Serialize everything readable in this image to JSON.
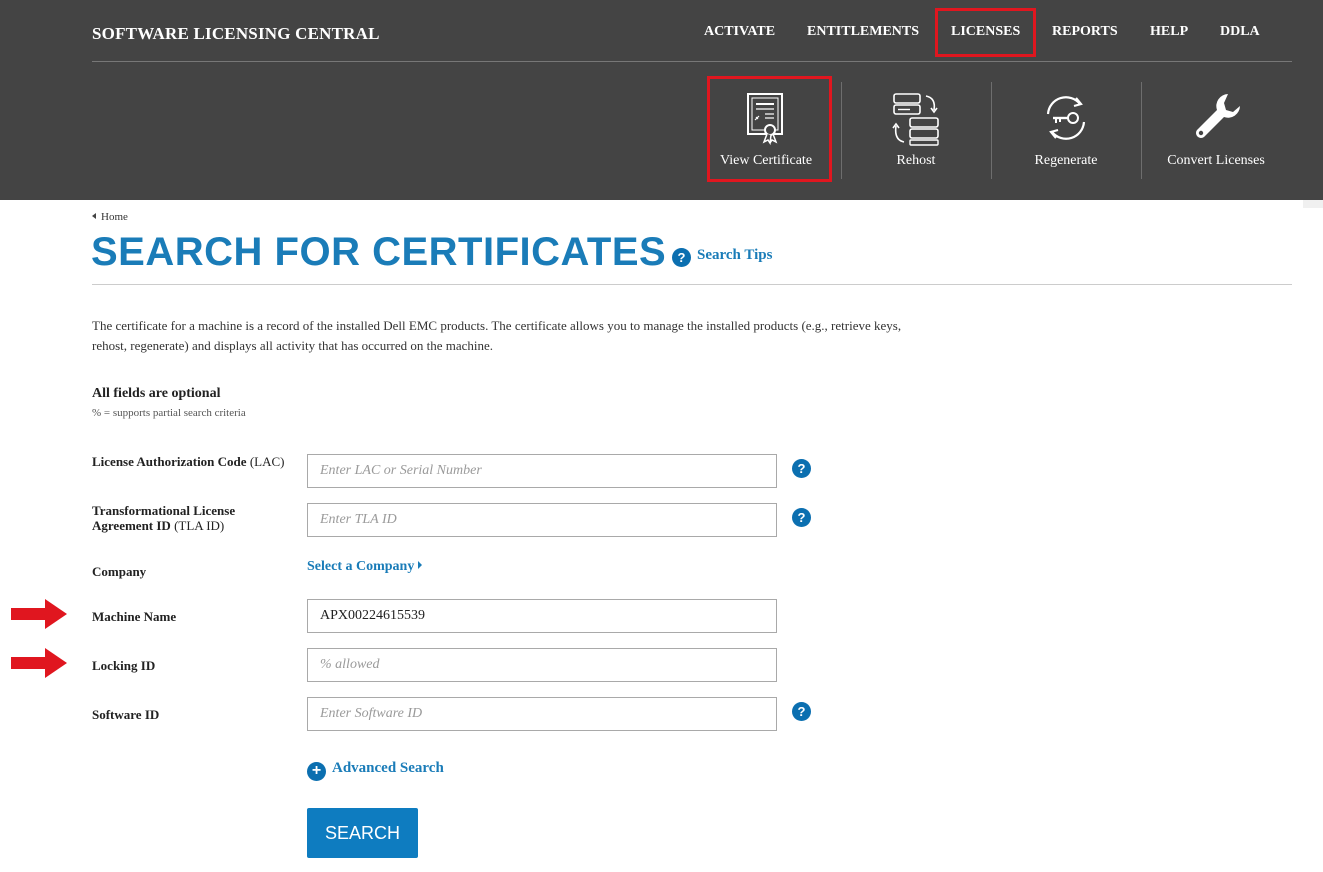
{
  "header": {
    "brand": "SOFTWARE LICENSING CENTRAL",
    "nav": [
      {
        "label": "ACTIVATE"
      },
      {
        "label": "ENTITLEMENTS"
      },
      {
        "label": "LICENSES",
        "active": true
      },
      {
        "label": "REPORTS"
      },
      {
        "label": "HELP"
      },
      {
        "label": "DDLA"
      }
    ],
    "tools": [
      {
        "label": "View Certificate",
        "icon": "certificate-icon",
        "active": true
      },
      {
        "label": "Rehost",
        "icon": "server-transfer-icon"
      },
      {
        "label": "Regenerate",
        "icon": "key-refresh-icon"
      },
      {
        "label": "Convert Licenses",
        "icon": "wrench-icon"
      }
    ]
  },
  "breadcrumb": {
    "label": "Home"
  },
  "page": {
    "title": "SEARCH FOR CERTIFICATES",
    "search_tips": "Search Tips",
    "description": "The certificate for a machine is a record of the installed Dell EMC products. The certificate allows you to manage the installed products (e.g., retrieve keys, rehost, regenerate) and displays all activity that has occurred on the machine.",
    "optional_title": "All fields are optional",
    "optional_sub": "% = supports partial search criteria"
  },
  "form": {
    "lac": {
      "label_bold": "License Authorization Code",
      "label_rest": " (LAC)",
      "value": "",
      "placeholder": "Enter LAC or Serial Number"
    },
    "tla": {
      "label_bold_1": "Transformational License",
      "label_bold_2": "Agreement ID",
      "label_rest": " (TLA ID)",
      "value": "",
      "placeholder": "Enter TLA ID"
    },
    "company": {
      "label": "Company",
      "link": "Select a Company"
    },
    "machine_name": {
      "label": "Machine Name",
      "value": "APX00224615539",
      "placeholder": ""
    },
    "locking_id": {
      "label": "Locking ID",
      "value": "",
      "placeholder": "% allowed"
    },
    "software_id": {
      "label": "Software ID",
      "value": "",
      "placeholder": "Enter Software ID"
    },
    "help_glyph": "?",
    "advanced_glyph": "+",
    "advanced_label": "Advanced Search",
    "submit_label": "SEARCH"
  },
  "colors": {
    "header_bg": "#444444",
    "accent_blue": "#1a7cb8",
    "button_blue": "#0e7cc0",
    "highlight_red": "#e0161f"
  }
}
